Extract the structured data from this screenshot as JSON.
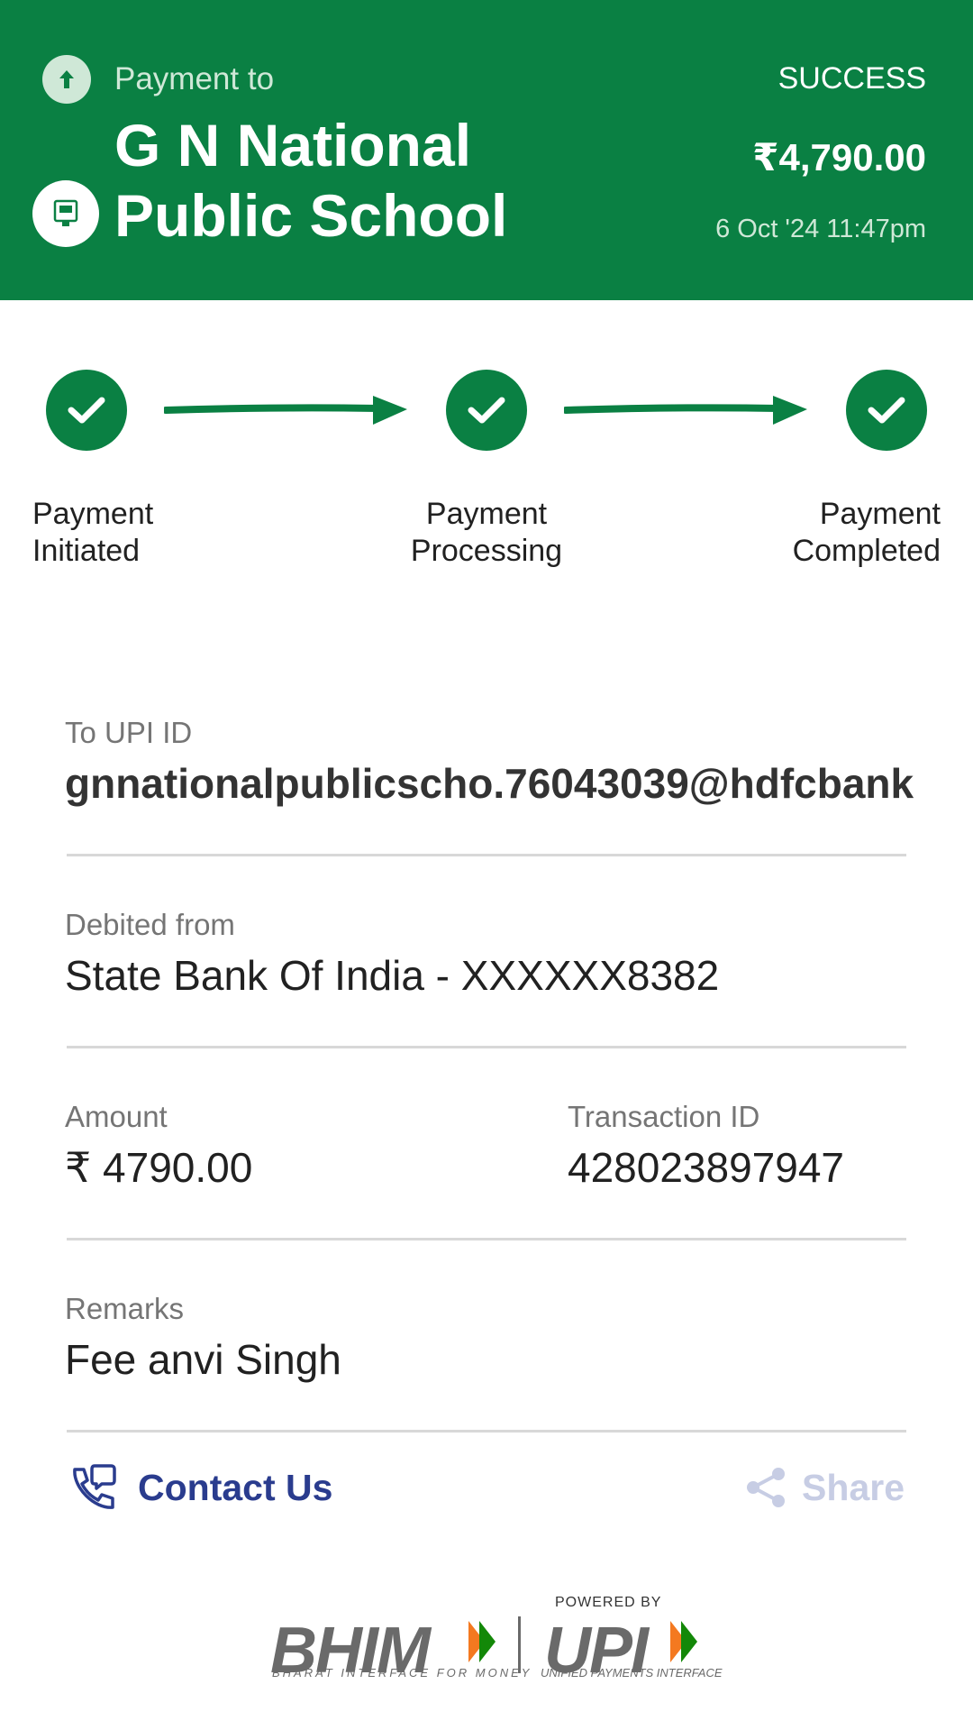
{
  "header": {
    "payment_to_label": "Payment to",
    "payee_line1": "G N National",
    "payee_line2": "Public School",
    "status": "SUCCESS",
    "amount": "₹4,790.00",
    "datetime": "6 Oct '24 11:47pm",
    "icons": [
      "arrow-up-icon",
      "bank-building-icon"
    ]
  },
  "progress": {
    "steps": [
      {
        "line1": "Payment",
        "line2": "Initiated"
      },
      {
        "line1": "Payment",
        "line2": "Processing"
      },
      {
        "line1": "Payment",
        "line2": "Completed"
      }
    ]
  },
  "details": {
    "upi_label": "To UPI ID",
    "upi_value": "gnnationalpublicscho.76043039@hdfcbank",
    "debited_label": "Debited from",
    "debited_value": "State Bank Of India - XXXXXX8382",
    "amount_label": "Amount",
    "amount_value": "₹ 4790.00",
    "txn_label": "Transaction ID",
    "txn_value": "428023897947",
    "remarks_label": "Remarks",
    "remarks_value": "Fee anvi Singh"
  },
  "actions": {
    "contact_label": "Contact Us",
    "share_label": "Share"
  },
  "footer": {
    "bhim": "BHIM",
    "bhim_sub": "BHARAT INTERFACE FOR MONEY",
    "powered_by": "POWERED BY",
    "upi": "UPI",
    "upi_sub": "UNIFIED PAYMENTS INTERFACE"
  },
  "colors": {
    "brand_green": "#0a8043",
    "link_blue": "#2a3c8e",
    "muted_label": "#757575"
  }
}
